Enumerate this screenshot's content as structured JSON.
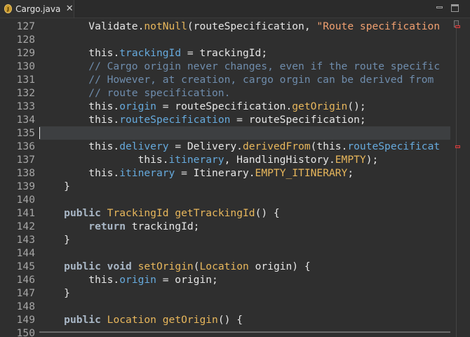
{
  "tab": {
    "title": "Cargo.java",
    "icon_name": "java-file-icon",
    "icon_letter": "J",
    "close_glyph": "✕"
  },
  "window_controls": {
    "minimize": "minimize-icon",
    "maximize": "maximize-icon"
  },
  "editor": {
    "current_line": "135",
    "lines": [
      {
        "num": "127",
        "tokens": [
          {
            "t": "        Validate.",
            "c": "plain"
          },
          {
            "t": "notNull",
            "c": "method"
          },
          {
            "t": "(routeSpecification, ",
            "c": "plain"
          },
          {
            "t": "\"Route specification",
            "c": "string"
          }
        ]
      },
      {
        "num": "128",
        "tokens": []
      },
      {
        "num": "129",
        "tokens": [
          {
            "t": "        ",
            "c": "plain"
          },
          {
            "t": "this",
            "c": "plain"
          },
          {
            "t": ".",
            "c": "plain"
          },
          {
            "t": "trackingId",
            "c": "field"
          },
          {
            "t": " = trackingId;",
            "c": "plain"
          }
        ]
      },
      {
        "num": "130",
        "tokens": [
          {
            "t": "        // Cargo origin never changes, even if the route specific",
            "c": "comment"
          }
        ]
      },
      {
        "num": "131",
        "tokens": [
          {
            "t": "        // However, at creation, cargo orgin can be derived from",
            "c": "comment"
          }
        ]
      },
      {
        "num": "132",
        "tokens": [
          {
            "t": "        // route specification.",
            "c": "comment"
          }
        ]
      },
      {
        "num": "133",
        "tokens": [
          {
            "t": "        this.",
            "c": "plain"
          },
          {
            "t": "origin",
            "c": "field"
          },
          {
            "t": " = routeSpecification.",
            "c": "plain"
          },
          {
            "t": "getOrigin",
            "c": "method"
          },
          {
            "t": "();",
            "c": "plain"
          }
        ]
      },
      {
        "num": "134",
        "tokens": [
          {
            "t": "        this.",
            "c": "plain"
          },
          {
            "t": "routeSpecification",
            "c": "field"
          },
          {
            "t": " = routeSpecification;",
            "c": "plain"
          }
        ]
      },
      {
        "num": "135",
        "tokens": []
      },
      {
        "num": "136",
        "tokens": [
          {
            "t": "        this.",
            "c": "plain"
          },
          {
            "t": "delivery",
            "c": "field"
          },
          {
            "t": " = Delivery.",
            "c": "plain"
          },
          {
            "t": "derivedFrom",
            "c": "method"
          },
          {
            "t": "(this.",
            "c": "plain"
          },
          {
            "t": "routeSpecificat",
            "c": "field"
          }
        ]
      },
      {
        "num": "137",
        "tokens": [
          {
            "t": "                this.",
            "c": "plain"
          },
          {
            "t": "itinerary",
            "c": "field"
          },
          {
            "t": ", HandlingHistory.",
            "c": "plain"
          },
          {
            "t": "EMPTY",
            "c": "const"
          },
          {
            "t": ");",
            "c": "plain"
          }
        ]
      },
      {
        "num": "138",
        "tokens": [
          {
            "t": "        this.",
            "c": "plain"
          },
          {
            "t": "itinerary",
            "c": "field"
          },
          {
            "t": " = Itinerary.",
            "c": "plain"
          },
          {
            "t": "EMPTY_ITINERARY",
            "c": "const"
          },
          {
            "t": ";",
            "c": "plain"
          }
        ]
      },
      {
        "num": "139",
        "tokens": [
          {
            "t": "    }",
            "c": "plain"
          }
        ]
      },
      {
        "num": "140",
        "tokens": []
      },
      {
        "num": "141",
        "tokens": [
          {
            "t": "    ",
            "c": "plain"
          },
          {
            "t": "public",
            "c": "kw2"
          },
          {
            "t": " ",
            "c": "plain"
          },
          {
            "t": "TrackingId",
            "c": "type"
          },
          {
            "t": " ",
            "c": "plain"
          },
          {
            "t": "getTrackingId",
            "c": "method"
          },
          {
            "t": "() {",
            "c": "plain"
          }
        ]
      },
      {
        "num": "142",
        "tokens": [
          {
            "t": "        ",
            "c": "plain"
          },
          {
            "t": "return",
            "c": "kw2"
          },
          {
            "t": " trackingId;",
            "c": "plain"
          }
        ]
      },
      {
        "num": "143",
        "tokens": [
          {
            "t": "    }",
            "c": "plain"
          }
        ]
      },
      {
        "num": "144",
        "tokens": []
      },
      {
        "num": "145",
        "tokens": [
          {
            "t": "    ",
            "c": "plain"
          },
          {
            "t": "public",
            "c": "kw2"
          },
          {
            "t": " ",
            "c": "plain"
          },
          {
            "t": "void",
            "c": "kw2"
          },
          {
            "t": " ",
            "c": "plain"
          },
          {
            "t": "setOrigin",
            "c": "method"
          },
          {
            "t": "(",
            "c": "plain"
          },
          {
            "t": "Location",
            "c": "type"
          },
          {
            "t": " origin) {",
            "c": "plain"
          }
        ]
      },
      {
        "num": "146",
        "tokens": [
          {
            "t": "        this.",
            "c": "plain"
          },
          {
            "t": "origin",
            "c": "field"
          },
          {
            "t": " = origin;",
            "c": "plain"
          }
        ]
      },
      {
        "num": "147",
        "tokens": [
          {
            "t": "    }",
            "c": "plain"
          }
        ]
      },
      {
        "num": "148",
        "tokens": []
      },
      {
        "num": "149",
        "tokens": [
          {
            "t": "    ",
            "c": "plain"
          },
          {
            "t": "public",
            "c": "kw2"
          },
          {
            "t": " ",
            "c": "plain"
          },
          {
            "t": "Location",
            "c": "type"
          },
          {
            "t": " ",
            "c": "plain"
          },
          {
            "t": "getOrigin",
            "c": "method"
          },
          {
            "t": "() {",
            "c": "plain"
          }
        ]
      },
      {
        "num": "150",
        "tokens": []
      }
    ]
  },
  "markers": {
    "error_lines": [
      "127",
      "136"
    ]
  },
  "colors": {
    "background": "#2f2f2f",
    "current_line": "#3d3f41",
    "keyword": "#a9b7c6",
    "field": "#66aadd",
    "method": "#e8b75c",
    "comment": "#6f8dad",
    "string": "#f0a070",
    "line_number": "#a6a6a6"
  }
}
